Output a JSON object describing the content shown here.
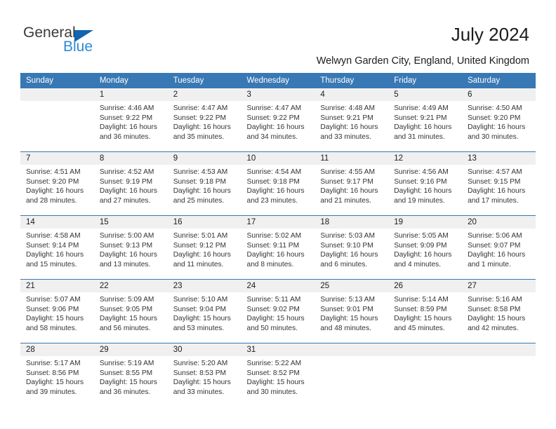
{
  "brand": {
    "name_part1": "General",
    "name_part2": "Blue",
    "accent_color": "#1064b0",
    "secondary_color": "#2e8ad6"
  },
  "header": {
    "title": "July 2024",
    "subtitle": "Welwyn Garden City, England, United Kingdom"
  },
  "theme": {
    "header_row_color": "#3878b4",
    "date_strip_color": "#f0f0f0",
    "text_color": "#333333"
  },
  "weekday_headers": [
    "Sunday",
    "Monday",
    "Tuesday",
    "Wednesday",
    "Thursday",
    "Friday",
    "Saturday"
  ],
  "weeks": [
    [
      {
        "day": "",
        "sunrise": "",
        "sunset": "",
        "daylight1": "",
        "daylight2": "",
        "empty": true
      },
      {
        "day": "1",
        "sunrise": "Sunrise: 4:46 AM",
        "sunset": "Sunset: 9:22 PM",
        "daylight1": "Daylight: 16 hours",
        "daylight2": "and 36 minutes."
      },
      {
        "day": "2",
        "sunrise": "Sunrise: 4:47 AM",
        "sunset": "Sunset: 9:22 PM",
        "daylight1": "Daylight: 16 hours",
        "daylight2": "and 35 minutes."
      },
      {
        "day": "3",
        "sunrise": "Sunrise: 4:47 AM",
        "sunset": "Sunset: 9:22 PM",
        "daylight1": "Daylight: 16 hours",
        "daylight2": "and 34 minutes."
      },
      {
        "day": "4",
        "sunrise": "Sunrise: 4:48 AM",
        "sunset": "Sunset: 9:21 PM",
        "daylight1": "Daylight: 16 hours",
        "daylight2": "and 33 minutes."
      },
      {
        "day": "5",
        "sunrise": "Sunrise: 4:49 AM",
        "sunset": "Sunset: 9:21 PM",
        "daylight1": "Daylight: 16 hours",
        "daylight2": "and 31 minutes."
      },
      {
        "day": "6",
        "sunrise": "Sunrise: 4:50 AM",
        "sunset": "Sunset: 9:20 PM",
        "daylight1": "Daylight: 16 hours",
        "daylight2": "and 30 minutes."
      }
    ],
    [
      {
        "day": "7",
        "sunrise": "Sunrise: 4:51 AM",
        "sunset": "Sunset: 9:20 PM",
        "daylight1": "Daylight: 16 hours",
        "daylight2": "and 28 minutes."
      },
      {
        "day": "8",
        "sunrise": "Sunrise: 4:52 AM",
        "sunset": "Sunset: 9:19 PM",
        "daylight1": "Daylight: 16 hours",
        "daylight2": "and 27 minutes."
      },
      {
        "day": "9",
        "sunrise": "Sunrise: 4:53 AM",
        "sunset": "Sunset: 9:18 PM",
        "daylight1": "Daylight: 16 hours",
        "daylight2": "and 25 minutes."
      },
      {
        "day": "10",
        "sunrise": "Sunrise: 4:54 AM",
        "sunset": "Sunset: 9:18 PM",
        "daylight1": "Daylight: 16 hours",
        "daylight2": "and 23 minutes."
      },
      {
        "day": "11",
        "sunrise": "Sunrise: 4:55 AM",
        "sunset": "Sunset: 9:17 PM",
        "daylight1": "Daylight: 16 hours",
        "daylight2": "and 21 minutes."
      },
      {
        "day": "12",
        "sunrise": "Sunrise: 4:56 AM",
        "sunset": "Sunset: 9:16 PM",
        "daylight1": "Daylight: 16 hours",
        "daylight2": "and 19 minutes."
      },
      {
        "day": "13",
        "sunrise": "Sunrise: 4:57 AM",
        "sunset": "Sunset: 9:15 PM",
        "daylight1": "Daylight: 16 hours",
        "daylight2": "and 17 minutes."
      }
    ],
    [
      {
        "day": "14",
        "sunrise": "Sunrise: 4:58 AM",
        "sunset": "Sunset: 9:14 PM",
        "daylight1": "Daylight: 16 hours",
        "daylight2": "and 15 minutes."
      },
      {
        "day": "15",
        "sunrise": "Sunrise: 5:00 AM",
        "sunset": "Sunset: 9:13 PM",
        "daylight1": "Daylight: 16 hours",
        "daylight2": "and 13 minutes."
      },
      {
        "day": "16",
        "sunrise": "Sunrise: 5:01 AM",
        "sunset": "Sunset: 9:12 PM",
        "daylight1": "Daylight: 16 hours",
        "daylight2": "and 11 minutes."
      },
      {
        "day": "17",
        "sunrise": "Sunrise: 5:02 AM",
        "sunset": "Sunset: 9:11 PM",
        "daylight1": "Daylight: 16 hours",
        "daylight2": "and 8 minutes."
      },
      {
        "day": "18",
        "sunrise": "Sunrise: 5:03 AM",
        "sunset": "Sunset: 9:10 PM",
        "daylight1": "Daylight: 16 hours",
        "daylight2": "and 6 minutes."
      },
      {
        "day": "19",
        "sunrise": "Sunrise: 5:05 AM",
        "sunset": "Sunset: 9:09 PM",
        "daylight1": "Daylight: 16 hours",
        "daylight2": "and 4 minutes."
      },
      {
        "day": "20",
        "sunrise": "Sunrise: 5:06 AM",
        "sunset": "Sunset: 9:07 PM",
        "daylight1": "Daylight: 16 hours",
        "daylight2": "and 1 minute."
      }
    ],
    [
      {
        "day": "21",
        "sunrise": "Sunrise: 5:07 AM",
        "sunset": "Sunset: 9:06 PM",
        "daylight1": "Daylight: 15 hours",
        "daylight2": "and 58 minutes."
      },
      {
        "day": "22",
        "sunrise": "Sunrise: 5:09 AM",
        "sunset": "Sunset: 9:05 PM",
        "daylight1": "Daylight: 15 hours",
        "daylight2": "and 56 minutes."
      },
      {
        "day": "23",
        "sunrise": "Sunrise: 5:10 AM",
        "sunset": "Sunset: 9:04 PM",
        "daylight1": "Daylight: 15 hours",
        "daylight2": "and 53 minutes."
      },
      {
        "day": "24",
        "sunrise": "Sunrise: 5:11 AM",
        "sunset": "Sunset: 9:02 PM",
        "daylight1": "Daylight: 15 hours",
        "daylight2": "and 50 minutes."
      },
      {
        "day": "25",
        "sunrise": "Sunrise: 5:13 AM",
        "sunset": "Sunset: 9:01 PM",
        "daylight1": "Daylight: 15 hours",
        "daylight2": "and 48 minutes."
      },
      {
        "day": "26",
        "sunrise": "Sunrise: 5:14 AM",
        "sunset": "Sunset: 8:59 PM",
        "daylight1": "Daylight: 15 hours",
        "daylight2": "and 45 minutes."
      },
      {
        "day": "27",
        "sunrise": "Sunrise: 5:16 AM",
        "sunset": "Sunset: 8:58 PM",
        "daylight1": "Daylight: 15 hours",
        "daylight2": "and 42 minutes."
      }
    ],
    [
      {
        "day": "28",
        "sunrise": "Sunrise: 5:17 AM",
        "sunset": "Sunset: 8:56 PM",
        "daylight1": "Daylight: 15 hours",
        "daylight2": "and 39 minutes."
      },
      {
        "day": "29",
        "sunrise": "Sunrise: 5:19 AM",
        "sunset": "Sunset: 8:55 PM",
        "daylight1": "Daylight: 15 hours",
        "daylight2": "and 36 minutes."
      },
      {
        "day": "30",
        "sunrise": "Sunrise: 5:20 AM",
        "sunset": "Sunset: 8:53 PM",
        "daylight1": "Daylight: 15 hours",
        "daylight2": "and 33 minutes."
      },
      {
        "day": "31",
        "sunrise": "Sunrise: 5:22 AM",
        "sunset": "Sunset: 8:52 PM",
        "daylight1": "Daylight: 15 hours",
        "daylight2": "and 30 minutes."
      },
      {
        "day": "",
        "sunrise": "",
        "sunset": "",
        "daylight1": "",
        "daylight2": "",
        "empty": true
      },
      {
        "day": "",
        "sunrise": "",
        "sunset": "",
        "daylight1": "",
        "daylight2": "",
        "empty": true
      },
      {
        "day": "",
        "sunrise": "",
        "sunset": "",
        "daylight1": "",
        "daylight2": "",
        "empty": true
      }
    ]
  ]
}
